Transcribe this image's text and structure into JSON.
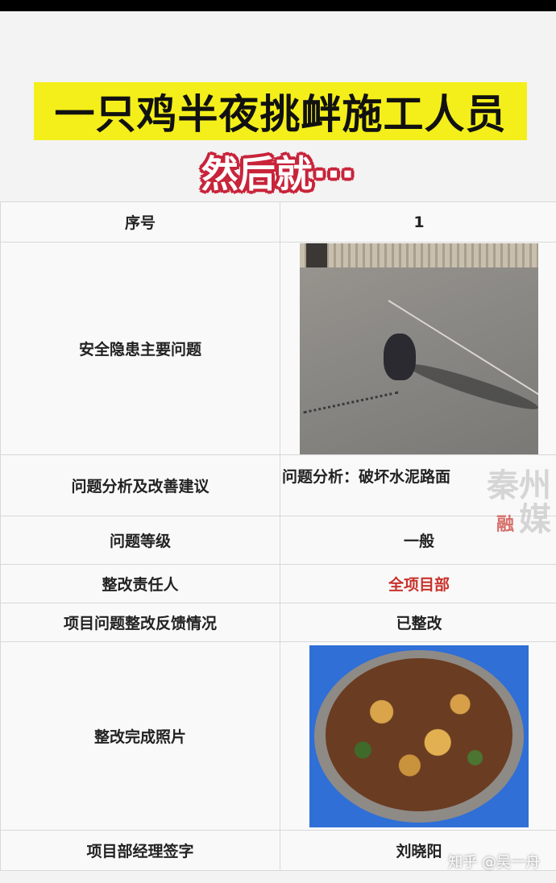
{
  "title": "一只鸡半夜挑衅施工人员",
  "subtitle": "然后就···",
  "rows": [
    {
      "label": "序号",
      "value": "1"
    },
    {
      "label": "安全隐患主要问题",
      "value_image": "photo-chicken-on-concrete"
    },
    {
      "label": "问题分析及改善建议",
      "value": "问题分析：破坏水泥路面"
    },
    {
      "label": "问题等级",
      "value": "一般"
    },
    {
      "label": "整改责任人",
      "value": "全项目部"
    },
    {
      "label": "项目问题整改反馈情况",
      "value": "已整改"
    },
    {
      "label": "整改完成照片",
      "value_image": "photo-stewed-chicken"
    },
    {
      "label": "项目部经理签字",
      "value": "刘晓阳"
    }
  ],
  "watermark": {
    "line1": "秦州",
    "line2_logo": "融",
    "line2_text": "媒"
  },
  "corner_watermark": "知乎 @吴一舟",
  "colors": {
    "banner": "#f4ef1a",
    "accent_red": "#c8322b"
  }
}
